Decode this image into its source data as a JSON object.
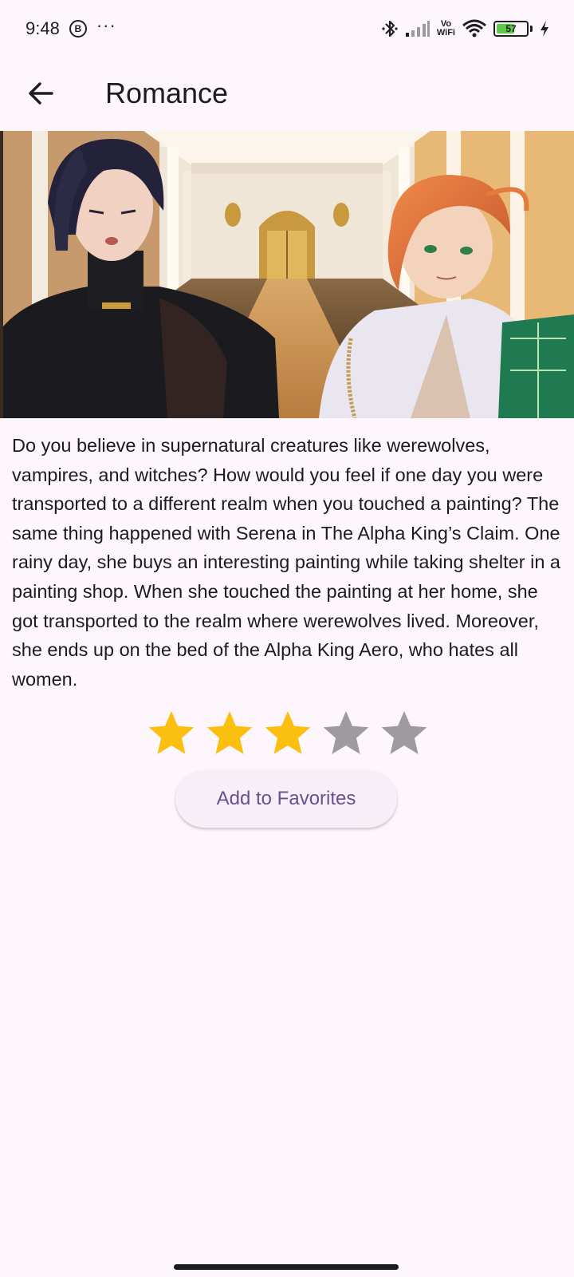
{
  "status_bar": {
    "time": "9:48",
    "badge_letter": "B",
    "overflow": "···",
    "vowifi_top": "Vo",
    "vowifi_bottom": "WiFi",
    "battery_level": "57",
    "battery_color": "#5cc94a"
  },
  "app_bar": {
    "back_icon": "arrow-back-icon",
    "title": "Romance"
  },
  "hero": {
    "icon": "comic-cover-illustration"
  },
  "description": "Do you believe in supernatural creatures like werewolves, vampires, and witches? How would you feel if one day you were transported to a different realm when you touched a painting? The same thing happened with Serena in The Alpha King’s Claim. One rainy day, she buys an interesting painting while taking shelter in a painting shop. When she touched the painting at her home, she got transported to the realm where werewolves lived. Moreover, she ends up on the bed of the Alpha King Aero, who hates all women.",
  "rating": {
    "value": 3,
    "max": 5,
    "filled_color": "#fbbf0f",
    "empty_color": "#9e9aa0"
  },
  "favorites_button": {
    "label": "Add to Favorites"
  },
  "colors": {
    "background": "#fdf7fd",
    "button_bg": "#f6eff7",
    "button_text": "#6a4f92"
  }
}
